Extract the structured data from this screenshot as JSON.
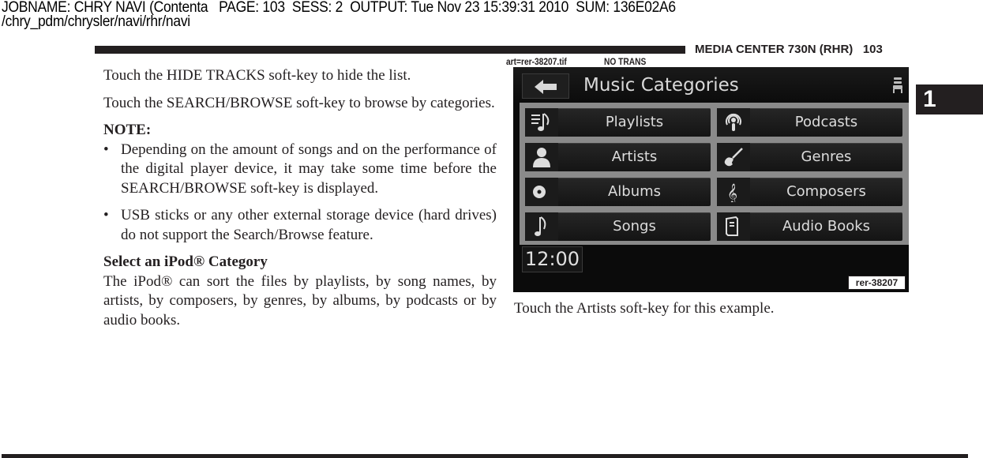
{
  "print_header": {
    "job_line": "JOBNAME: CHRY NAVI (Contenta   PAGE: 103  SESS: 2  OUTPUT: Tue Nov 23 15:39:31 2010  SUM: 136E02A6",
    "path_line": "/chry_pdm/chrysler/navi/rhr/navi"
  },
  "running_head": {
    "title": "MEDIA CENTER 730N (RHR)",
    "page_number": "103"
  },
  "art_label": {
    "file": "art=rer-38207.tif",
    "translation": "NO TRANS"
  },
  "section_tab": "1",
  "left_column": {
    "para1": "Touch the HIDE TRACKS soft-key to hide the list.",
    "para2": "Touch the SEARCH/BROWSE soft-key to browse by categories.",
    "note_label": "NOTE:",
    "bullet_symbol": "•",
    "bullets": [
      "Depending on the amount of songs and on the performance of the digital player device, it may take some time before the SEARCH/BROWSE soft-key is displayed.",
      "USB sticks or any other external storage device (hard drives) do not support the Search/Browse feature."
    ],
    "subheading": "Select an iPod® Category",
    "body": "The iPod® can sort the files by playlists, by song names, by artists, by composers, by genres, by albums, by podcasts or by audio books."
  },
  "screen": {
    "title": "Music Categories",
    "back_icon": "arrow-left-icon",
    "seat_icon": "seat-icon",
    "categories": [
      {
        "label": "Playlists",
        "icon": "playlist-icon"
      },
      {
        "label": "Podcasts",
        "icon": "podcast-icon"
      },
      {
        "label": "Artists",
        "icon": "person-icon"
      },
      {
        "label": "Genres",
        "icon": "guitar-icon"
      },
      {
        "label": "Albums",
        "icon": "disc-icon"
      },
      {
        "label": "Composers",
        "icon": "treble-clef-icon"
      },
      {
        "label": "Songs",
        "icon": "music-note-icon"
      },
      {
        "label": "Audio Books",
        "icon": "book-icon"
      }
    ],
    "clock": "12:00"
  },
  "figure_id": "rer-38207",
  "caption": "Touch the Artists soft-key for this example."
}
